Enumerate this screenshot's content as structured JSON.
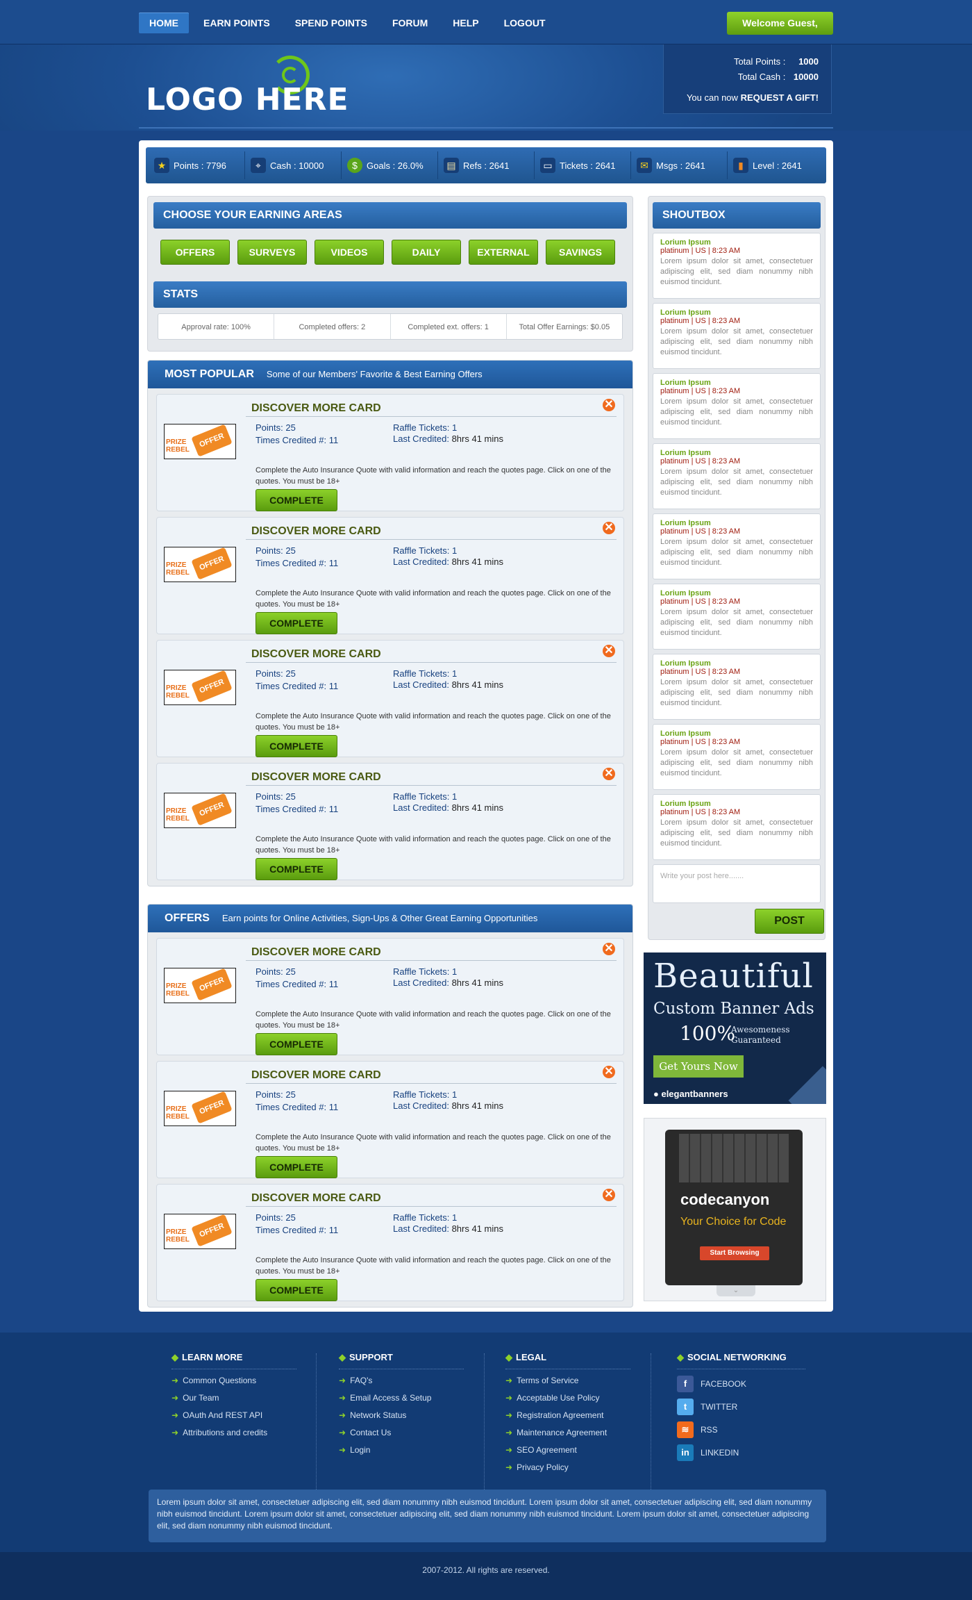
{
  "nav": {
    "items": [
      "HOME",
      "EARN POINTS",
      "SPEND POINTS",
      "FORUM",
      "HELP",
      "LOGOUT"
    ],
    "welcome": "Welcome Guest,"
  },
  "logo": {
    "text": "LOGO HERE"
  },
  "totals": {
    "points_label": "Total Points :",
    "points_value": "1000",
    "cash_label": "Total Cash :",
    "cash_value": "10000",
    "gift_prefix": "You can now",
    "gift_link": "REQUEST A GIFT!"
  },
  "statbar": [
    {
      "icon": "star-icon",
      "glyph": "★",
      "text": "Points : 7796"
    },
    {
      "icon": "crosshair-icon",
      "glyph": "⌖",
      "text": "Cash : 10000"
    },
    {
      "icon": "dollar-icon",
      "glyph": "$",
      "text": "Goals : 26.0%"
    },
    {
      "icon": "document-icon",
      "glyph": "▤",
      "text": "Refs : 2641"
    },
    {
      "icon": "ticket-icon",
      "glyph": "▭",
      "text": "Tickets : 2641"
    },
    {
      "icon": "mail-icon",
      "glyph": "✉",
      "text": "Msgs : 2641"
    },
    {
      "icon": "bar-chart-icon",
      "glyph": "▮",
      "text": "Level : 2641"
    }
  ],
  "earning": {
    "title": "CHOOSE YOUR EARNING AREAS",
    "buttons": [
      "OFFERS",
      "SURVEYS",
      "VIDEOS",
      "DAILY",
      "EXTERNAL",
      "SAVINGS"
    ]
  },
  "stats": {
    "title": "STATS",
    "cells": [
      "Approval rate: 100%",
      "Completed offers: 2",
      "Completed ext. offers: 1",
      "Total Offer Earnings: $0.05"
    ]
  },
  "popular": {
    "title": "MOST POPULAR",
    "subtitle": "Some of our Members' Favorite & Best Earning Offers"
  },
  "offers": {
    "title": "OFFERS",
    "subtitle": "Earn points for Online Activities, Sign-Ups & Other Great Earning Opportunities"
  },
  "card": {
    "title": "DISCOVER MORE CARD",
    "points": "Points: 25",
    "times": "Times Credited #: 11",
    "raffle": "Raffle Tickets: 1",
    "last_label": "Last Credited:",
    "last_value": "8hrs 41 mins",
    "desc": "Complete the Auto Insurance Quote with valid information and reach the quotes page. Click on one of the quotes. You must be 18+",
    "button": "COMPLETE",
    "img_prize": "PRIZE",
    "img_rebel": "REBEL",
    "img_offer": "OFFER"
  },
  "shoutbox": {
    "title": "SHOUTBOX",
    "name": "Lorium Ipsum",
    "meta": "platinum | US | 8:23 AM",
    "text": "Lorem ipsum dolor sit amet, consectetuer adipiscing elit, sed diam nonummy nibh euismod tincidunt.",
    "placeholder": "Write your post here.......",
    "post": "POST"
  },
  "ad1": {
    "big": "Beautiful",
    "sub": "Custom Banner Ads",
    "pct": "100%",
    "aw1": "Awesomeness",
    "aw2": "Guaranteed",
    "button": "Get Yours Now",
    "brand": "elegantbanners"
  },
  "ad2": {
    "brand": "codecanyon",
    "tag": "Your Choice for Code",
    "button": "Start Browsing"
  },
  "footer": {
    "learn": {
      "title": "LEARN MORE",
      "items": [
        "Common Questions",
        "Our Team",
        "OAuth And REST API",
        "Attributions and credits"
      ]
    },
    "support": {
      "title": "SUPPORT",
      "items": [
        "FAQ's",
        "Email Access & Setup",
        "Network Status",
        "Contact Us",
        "Login"
      ]
    },
    "legal": {
      "title": "LEGAL",
      "items": [
        "Terms of Service",
        "Acceptable Use Policy",
        "Registration Agreement",
        "Maintenance Agreement",
        "SEO Agreement",
        "Privacy Policy"
      ]
    },
    "social": {
      "title": "SOCIAL NETWORKING",
      "items": [
        {
          "label": "FACEBOOK",
          "glyph": "f",
          "color": "#3b5998"
        },
        {
          "label": "TWITTER",
          "glyph": "t",
          "color": "#55acee"
        },
        {
          "label": "RSS",
          "glyph": "≋",
          "color": "#f26b1d"
        },
        {
          "label": "LINKEDIN",
          "glyph": "in",
          "color": "#1a7bb9"
        }
      ]
    },
    "note": "Lorem ipsum dolor sit amet, consectetuer adipiscing elit, sed diam nonummy nibh euismod tincidunt. Lorem ipsum dolor sit amet, consectetuer adipiscing elit, sed diam nonummy nibh euismod tincidunt. Lorem ipsum dolor sit amet, consectetuer adipiscing elit, sed diam nonummy nibh euismod tincidunt. Lorem ipsum dolor sit amet, consectetuer adipiscing elit, sed diam nonummy nibh euismod tincidunt.",
    "copyright": "2007-2012. All rights are reserved."
  }
}
